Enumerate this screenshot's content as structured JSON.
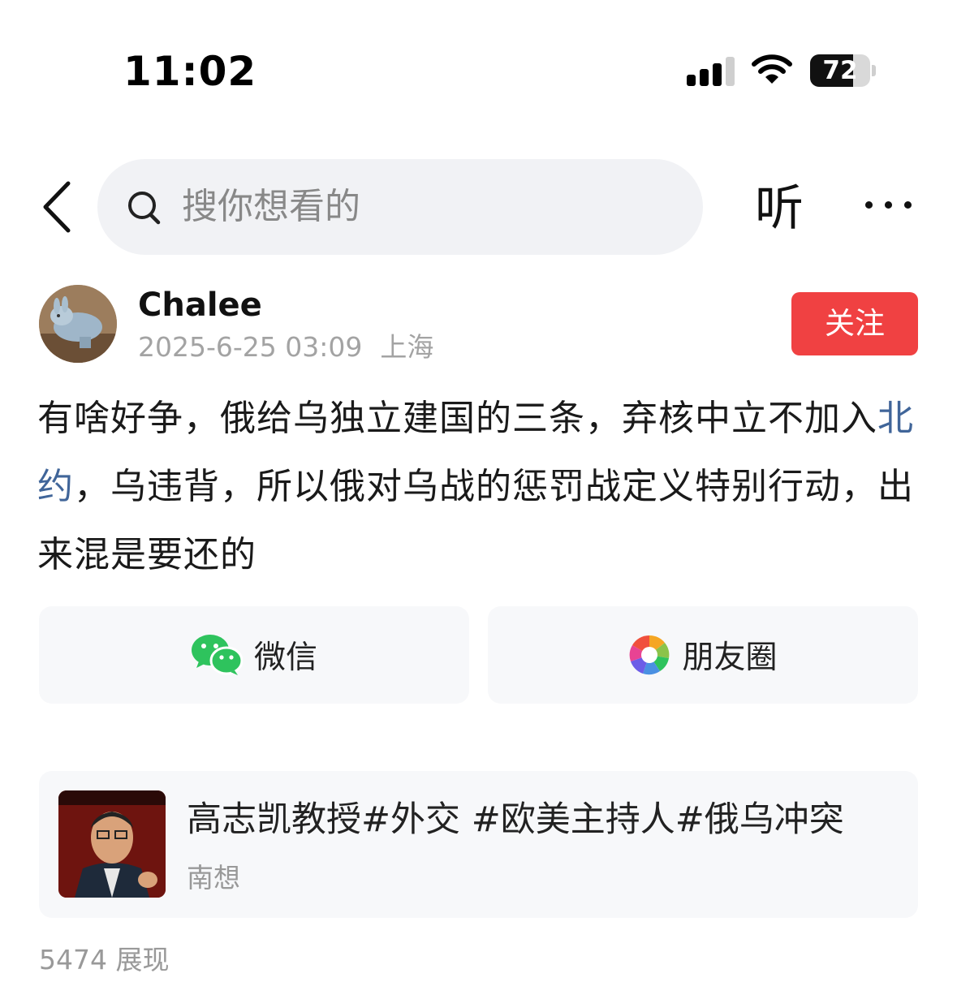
{
  "status_bar": {
    "time": "11:02",
    "battery": "72",
    "battery_level": 0.72
  },
  "nav": {
    "search_placeholder": "搜你想看的",
    "listen_label": "听"
  },
  "post": {
    "author": "Chalee",
    "date": "2025-6-25 03:09",
    "location": "上海",
    "follow_label": "关注",
    "text_before": "有啥好争，俄给乌独立建国的三条，弃核中立不加入",
    "link_text": "北约",
    "text_after": "，乌违背，所以俄对乌战的惩罚战定义特别行动，出来混是要还的"
  },
  "share": {
    "wechat_label": "微信",
    "moments_label": "朋友圈"
  },
  "linked_card": {
    "title": "高志凯教授#外交 #欧美主持人#俄乌冲突",
    "source": "南想"
  },
  "views": "5474 展现",
  "colors": {
    "follow_bg": "#f04142",
    "link": "#406599",
    "wechat_green": "#2ec35d"
  }
}
